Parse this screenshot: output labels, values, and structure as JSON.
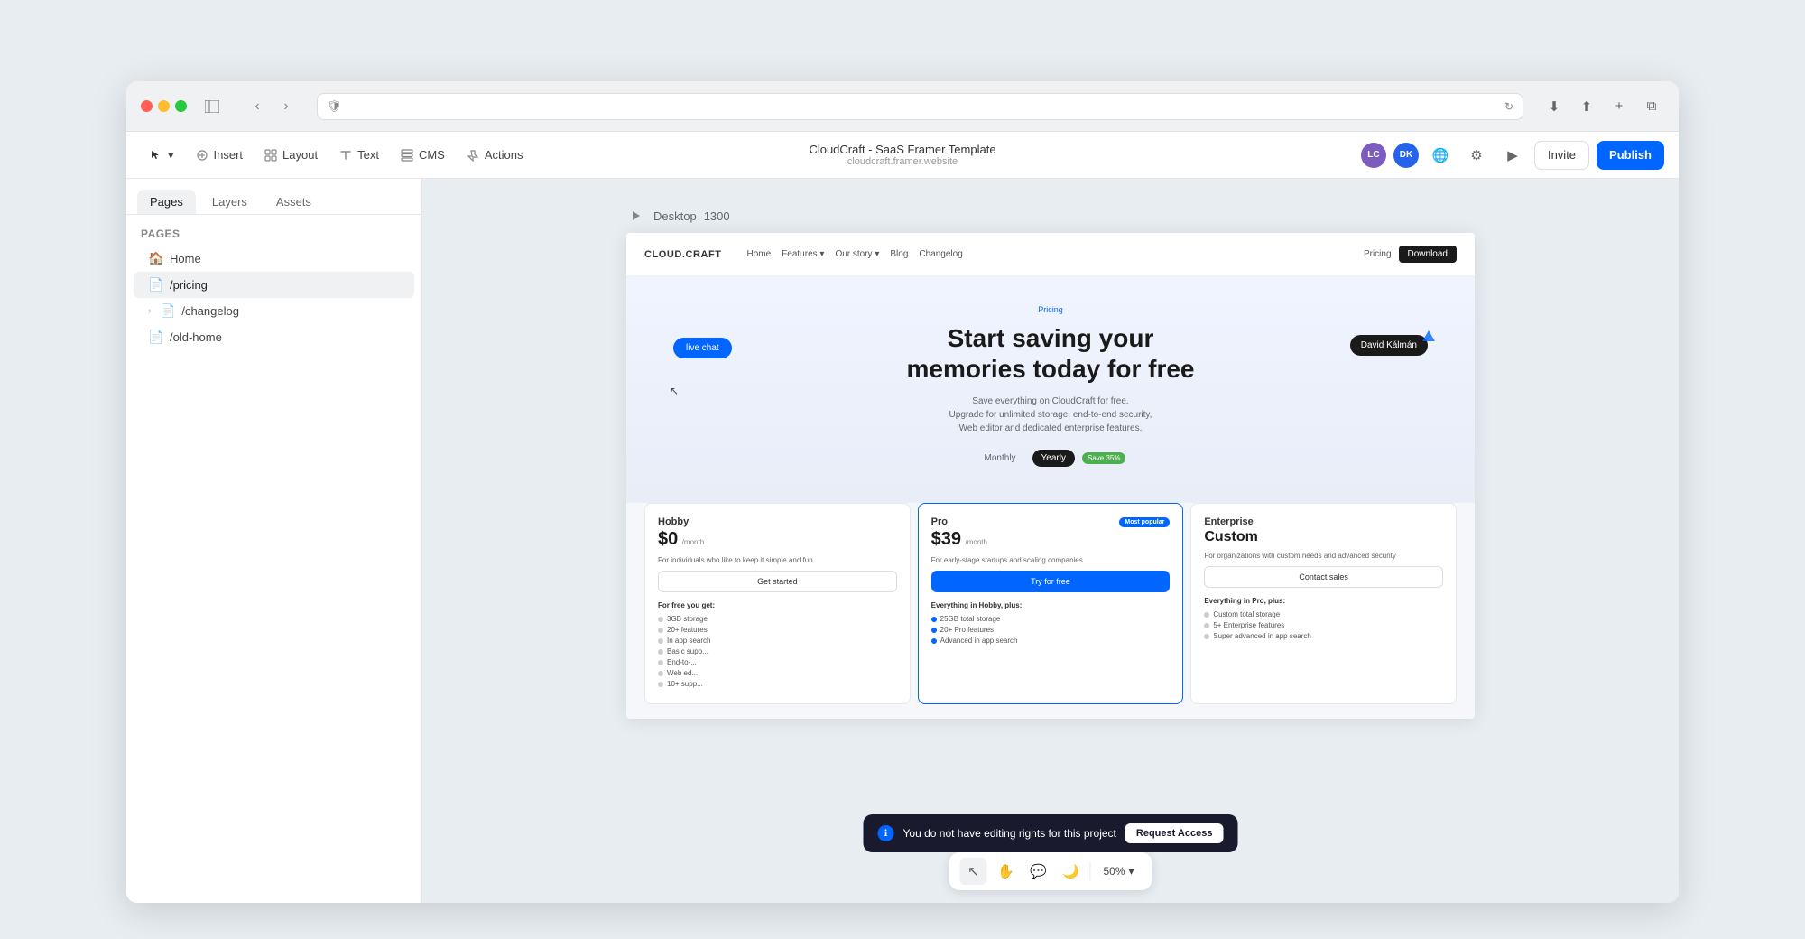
{
  "browser": {
    "address": "",
    "address_placeholder": "",
    "sidebar_icon": "⊞",
    "back_icon": "‹",
    "forward_icon": "›",
    "download_icon": "⬇",
    "share_icon": "⬆",
    "new_tab_icon": "+",
    "tabs_icon": "⧉"
  },
  "toolbar": {
    "pointer_icon": "↖",
    "insert_label": "Insert",
    "layout_label": "Layout",
    "text_label": "Text",
    "cms_label": "CMS",
    "actions_label": "Actions",
    "project_title": "CloudCraft - SaaS Framer Template",
    "project_url": "cloudcraft.framer.website",
    "globe_icon": "🌐",
    "settings_icon": "⚙",
    "play_icon": "▶",
    "invite_label": "Invite",
    "publish_label": "Publish",
    "avatar_lc": "LC",
    "avatar_dk": "DK",
    "avatar_lc_color": "#7c5cbf",
    "avatar_dk_color": "#2563eb"
  },
  "sidebar": {
    "tab_pages": "Pages",
    "tab_layers": "Layers",
    "tab_assets": "Assets",
    "section_pages": "Pages",
    "pages": [
      {
        "id": "home",
        "label": "Home",
        "icon": "🏠",
        "active": false
      },
      {
        "id": "pricing",
        "label": "/pricing",
        "icon": "📄",
        "active": true
      },
      {
        "id": "changelog",
        "label": "/changelog",
        "icon": "📄",
        "active": false,
        "hasChevron": true
      },
      {
        "id": "old-home",
        "label": "/old-home",
        "icon": "📄",
        "active": false
      }
    ]
  },
  "preview": {
    "device_label": "Desktop",
    "device_size": "1300"
  },
  "website": {
    "nav": {
      "logo": "CLOUD.CRAFT",
      "links": [
        "Home",
        "Features ▾",
        "Our story ▾",
        "Blog",
        "Changelog"
      ],
      "pricing": "Pricing",
      "download_btn": "Download"
    },
    "hero": {
      "pricing_tag": "Pricing",
      "title_line1": "Start saving your",
      "title_line2": "memories today for free",
      "subtitle": "Save everything on CloudCraft for free.\nUpgrade for unlimited storage, end-to-end security,\nWeb editor and dedicated enterprise features.",
      "toggle_monthly": "Monthly",
      "toggle_yearly": "Yearly",
      "save_badge": "Save 35%"
    },
    "live_chat": "live chat",
    "david": "David Kálmán",
    "plans": [
      {
        "id": "hobby",
        "name": "Hobby",
        "price": "$0",
        "period": "/month",
        "desc": "For individuals who like to keep it simple and fun",
        "btn_label": "Get started",
        "btn_primary": false,
        "popular": false,
        "features_title": "For free you get:",
        "features": [
          "3GB storage",
          "20+ features",
          "In app search",
          "Basic supp...",
          "End-to-...",
          "Web ed...",
          "10+ supp..."
        ]
      },
      {
        "id": "pro",
        "name": "Pro",
        "price": "$39",
        "period": "/month",
        "desc": "For early-stage startups and scaling companies",
        "btn_label": "Try for free",
        "btn_primary": true,
        "popular": true,
        "popular_label": "Most popular",
        "features_title": "Everything in Hobby, plus:",
        "features": [
          "25GB total storage",
          "20+ Pro features",
          "Advanced in app search"
        ]
      },
      {
        "id": "enterprise",
        "name": "Enterprise",
        "price": "Custom",
        "period": "",
        "desc": "For organizations with custom needs and advanced security",
        "btn_label": "Contact sales",
        "btn_primary": false,
        "popular": false,
        "features_title": "Everything in Pro, plus:",
        "features": [
          "Custom total storage",
          "5+ Enterprise features",
          "Super advanced in app search"
        ]
      }
    ],
    "notification": {
      "text": "You do not have editing rights for this project",
      "btn_label": "Request Access"
    }
  },
  "bottom_toolbar": {
    "cursor_icon": "↖",
    "hand_icon": "✋",
    "comment_icon": "💬",
    "moon_icon": "🌙",
    "zoom_label": "50%",
    "chevron_icon": "▾"
  }
}
